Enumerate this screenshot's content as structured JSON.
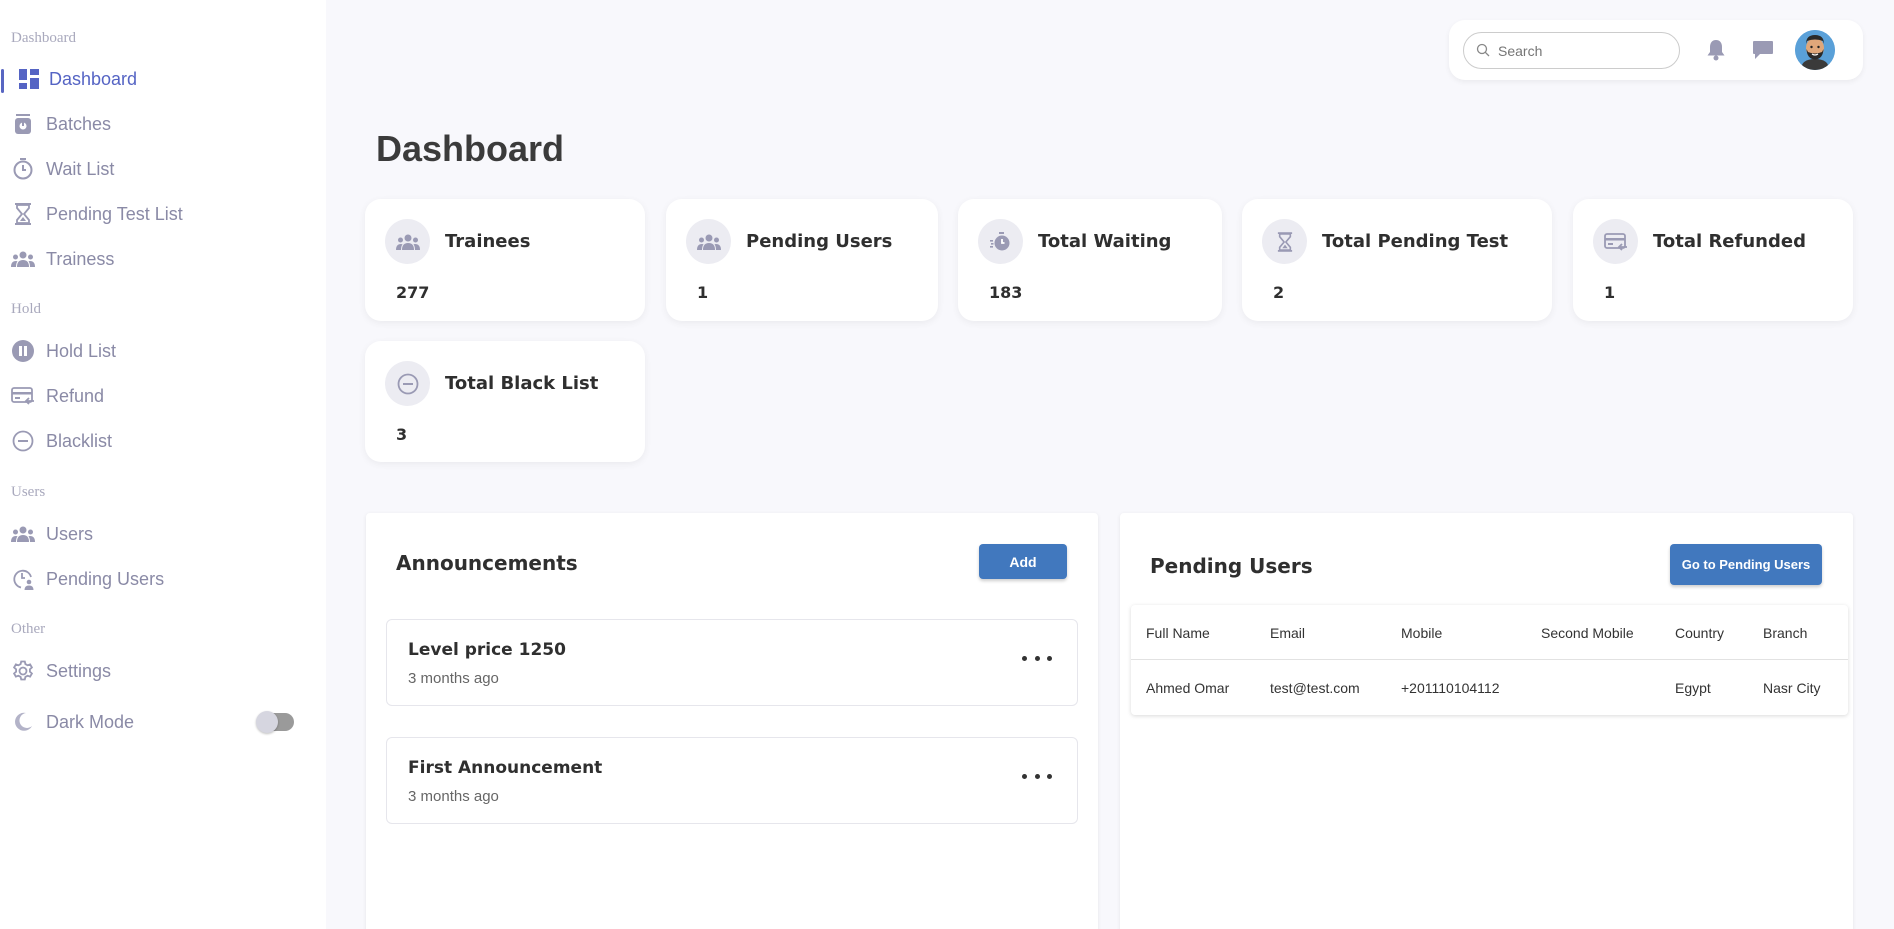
{
  "sidebar": {
    "sections": {
      "dashboard": "Dashboard",
      "hold": "Hold",
      "users": "Users",
      "other": "Other"
    },
    "items": [
      {
        "label": "Dashboard",
        "icon": "dashboard-icon",
        "active": true
      },
      {
        "label": "Batches",
        "icon": "batches-icon"
      },
      {
        "label": "Wait List",
        "icon": "timer-icon"
      },
      {
        "label": "Pending Test List",
        "icon": "hourglass-icon"
      },
      {
        "label": "Trainess",
        "icon": "group-icon"
      },
      {
        "label": "Hold List",
        "icon": "pause-icon"
      },
      {
        "label": "Refund",
        "icon": "refund-card-icon"
      },
      {
        "label": "Blacklist",
        "icon": "block-icon"
      },
      {
        "label": "Users",
        "icon": "group-icon"
      },
      {
        "label": "Pending Users",
        "icon": "pending-clock-user-icon"
      },
      {
        "label": "Settings",
        "icon": "gear-icon"
      }
    ],
    "dark_mode": {
      "label": "Dark Mode",
      "icon": "moon-icon",
      "enabled": false
    }
  },
  "topbar": {
    "search_placeholder": "Search",
    "icons": [
      "search-icon",
      "bell-icon",
      "chat-icon",
      "avatar"
    ]
  },
  "page_title": "Dashboard",
  "stats": [
    {
      "title": "Trainees",
      "value": "277",
      "icon": "group-icon"
    },
    {
      "title": "Pending Users",
      "value": "1",
      "icon": "group-icon"
    },
    {
      "title": "Total Waiting",
      "value": "183",
      "icon": "timer-icon"
    },
    {
      "title": "Total Pending Test",
      "value": "2",
      "icon": "hourglass-icon"
    },
    {
      "title": "Total Refunded",
      "value": "1",
      "icon": "refund-card-icon"
    },
    {
      "title": "Total Black List",
      "value": "3",
      "icon": "block-icon"
    }
  ],
  "announcements": {
    "title": "Announcements",
    "add_label": "Add",
    "items": [
      {
        "title": "Level price 1250",
        "time": "3 months ago"
      },
      {
        "title": "First Announcement",
        "time": "3 months ago"
      }
    ]
  },
  "pending_users": {
    "title": "Pending Users",
    "button_label": "Go to Pending Users",
    "columns": [
      "Full Name",
      "Email",
      "Mobile",
      "Second Mobile",
      "Country",
      "Branch"
    ],
    "rows": [
      [
        "Ahmed Omar",
        "test@test.com",
        "+201110104112",
        "",
        "Egypt",
        "Nasr City"
      ]
    ]
  },
  "colors": {
    "accent": "#5564c4",
    "button": "#4178be",
    "background": "#f8f8fc",
    "muted": "#8a8aa6"
  }
}
